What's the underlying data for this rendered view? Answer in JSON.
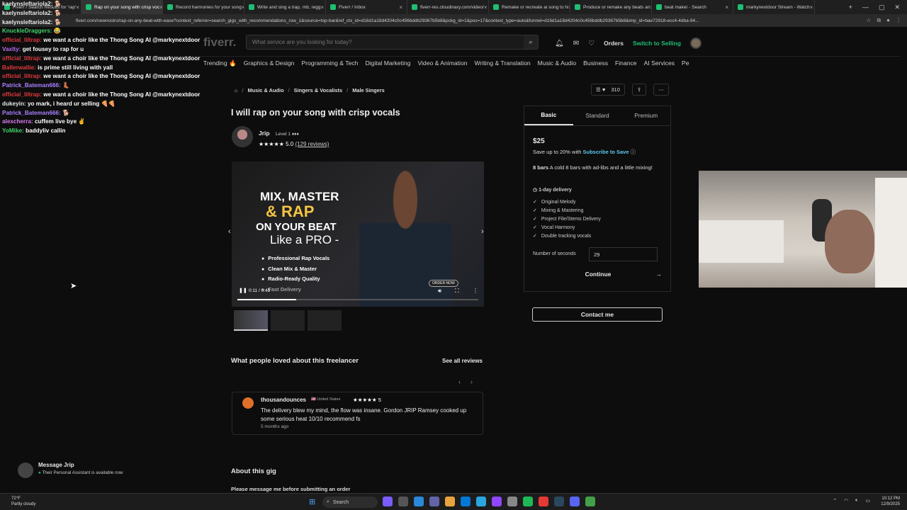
{
  "browser": {
    "tabs": [
      {
        "label": "Fiverr / Search Results for 'rap'",
        "active": false
      },
      {
        "label": "Rap on your song with crisp voc",
        "active": true
      },
      {
        "label": "Record harmonies for your song",
        "active": false
      },
      {
        "label": "Write and sing a trap, rnb, regg",
        "active": false
      },
      {
        "label": "Fiverr / Inbox",
        "active": false
      },
      {
        "label": "fiverr-res.cloudinary.com/video/",
        "active": false
      },
      {
        "label": "Remake or recreate ai song to hi",
        "active": false
      },
      {
        "label": "Produce or remake any beats an",
        "active": false
      },
      {
        "label": "beat maker - Search",
        "active": false
      },
      {
        "label": "markynextdoor Stream - Watch",
        "active": false
      }
    ],
    "url": "fiverr.com/newnostro/rap-on-any-beat-with-ease?context_referrer=search_gigs_with_recommendations_row_1&source=top-bar&ref_ctx_id=d16d1a18d4204c0c456bddb29367b5b8&pckg_id=1&pos=17&context_type=auto&funnel=d16d1a18d4204c0c456bddb29367b5b8&imp_id=bae72918-ecc4-4dba-94..."
  },
  "chat": [
    {
      "user": "kaelynsleftariola2:",
      "color": "#e8e8e8",
      "msg": "🐕"
    },
    {
      "user": "kaelynsleftariola2:",
      "color": "#e8e8e8",
      "msg": "🐕"
    },
    {
      "user": "kaelynsleftariola2:",
      "color": "#e8e8e8",
      "msg": "🐕"
    },
    {
      "user": "KnuckleDraggers:",
      "color": "#3fd16a",
      "msg": "😂"
    },
    {
      "user": "official_liltrap:",
      "color": "#e0393e",
      "msg": "we want a choir like the Thong Song AI @markynextdoor"
    },
    {
      "user": "Vaxlty:",
      "color": "#b46cf0",
      "msg": "get fousey to rap for u"
    },
    {
      "user": "official_liltrap:",
      "color": "#e0393e",
      "msg": "we want a choir like the Thong Song AI @markynextdoor"
    },
    {
      "user": "Ballerwallie:",
      "color": "#e0393e",
      "msg": "is prime still living with yall"
    },
    {
      "user": "official_liltrap:",
      "color": "#e0393e",
      "msg": "we want a choir like the Thong Song AI @markynextdoor"
    },
    {
      "user": "Patrick_Bateman666:",
      "color": "#a880ff",
      "msg": "👢"
    },
    {
      "user": "official_liltrap:",
      "color": "#e0393e",
      "msg": "we want a choir like the Thong Song AI @markynextdoor"
    },
    {
      "user": "dukeyin:",
      "color": "#e8e8e8",
      "msg": "yo mark, i heard ur selling 🍕🍕"
    },
    {
      "user": "Patrick_Bateman666:",
      "color": "#a880ff",
      "msg": "🐕"
    },
    {
      "user": "alexcherra:",
      "color": "#d77cf0",
      "msg": "cuffem live bye ✌"
    },
    {
      "user": "YoMike:",
      "color": "#3fd16a",
      "msg": "baddyliv callin"
    }
  ],
  "header": {
    "logo": "fiverr.",
    "search_placeholder": "What service are you looking for today?",
    "orders": "Orders",
    "switch": "Switch to Selling"
  },
  "categories": [
    "Trending 🔥",
    "Graphics & Design",
    "Programming & Tech",
    "Digital Marketing",
    "Video & Animation",
    "Writing & Translation",
    "Music & Audio",
    "Business",
    "Finance",
    "AI Services",
    "Pe"
  ],
  "breadcrumb": [
    "Music & Audio",
    "Singers & Vocalists",
    "Male Singers"
  ],
  "gig": {
    "like_count": "310",
    "title": "I will rap on your song with crisp vocals",
    "seller_name": "Jrip",
    "seller_level": "Level 1 ♦♦♦",
    "rating": "★★★★★ 5.0",
    "reviews": "(129 reviews)"
  },
  "video": {
    "line1": "MIX, MASTER",
    "line2": "& RAP",
    "line3": "ON YOUR BEAT",
    "line4": "Like a PRO  -",
    "bullets": [
      "Professional Rap Vocals",
      "Clean Mix & Master",
      "Radio-Ready Quality",
      "Fast Delivery"
    ],
    "order_now": "ORDER NOW",
    "time": "0:11 / 0:45",
    "progress": 0.244
  },
  "reviews": {
    "title": "What people loved about this freelancer",
    "see_all": "See all reviews",
    "reviewer": "thousandounces",
    "country": "🇺🇸 United States",
    "stars": "★★★★★ 5",
    "text": "The delivery blew my mind, the flow was insane. Gordon JRIP Ramsey cooked up some serious heat 10/10 recommend fs",
    "age": "5 months ago"
  },
  "about": {
    "title": "About this gig",
    "text": "Please message me before submitting an order"
  },
  "package": {
    "tabs": [
      "Basic",
      "Standard",
      "Premium"
    ],
    "price": "$25",
    "save_prefix": "Save up to 20% with",
    "save_link": "Subscribe to Save",
    "desc_bold": "8 bars",
    "desc": "A cold 8 bars with ad-libs and a little mixing!",
    "delivery": "1-day delivery",
    "features": [
      "Original Melody",
      "Mixing & Mastering",
      "Project File/Stems Delivery",
      "Vocal Harmony",
      "Double tracking vocals"
    ],
    "seconds_label": "Number of seconds",
    "seconds_value": "29",
    "continue": "Continue",
    "contact": "Contact me"
  },
  "message": {
    "title": "Message Jrip",
    "subtitle": "Their Personal Assistant is available now"
  },
  "taskbar": {
    "temp": "72°F",
    "weather": "Partly cloudy",
    "search": "Search",
    "time": "10:12 PM",
    "date": "12/9/2025"
  },
  "colors": {
    "accent": "#1dbf73",
    "link": "#5ec8f0"
  }
}
